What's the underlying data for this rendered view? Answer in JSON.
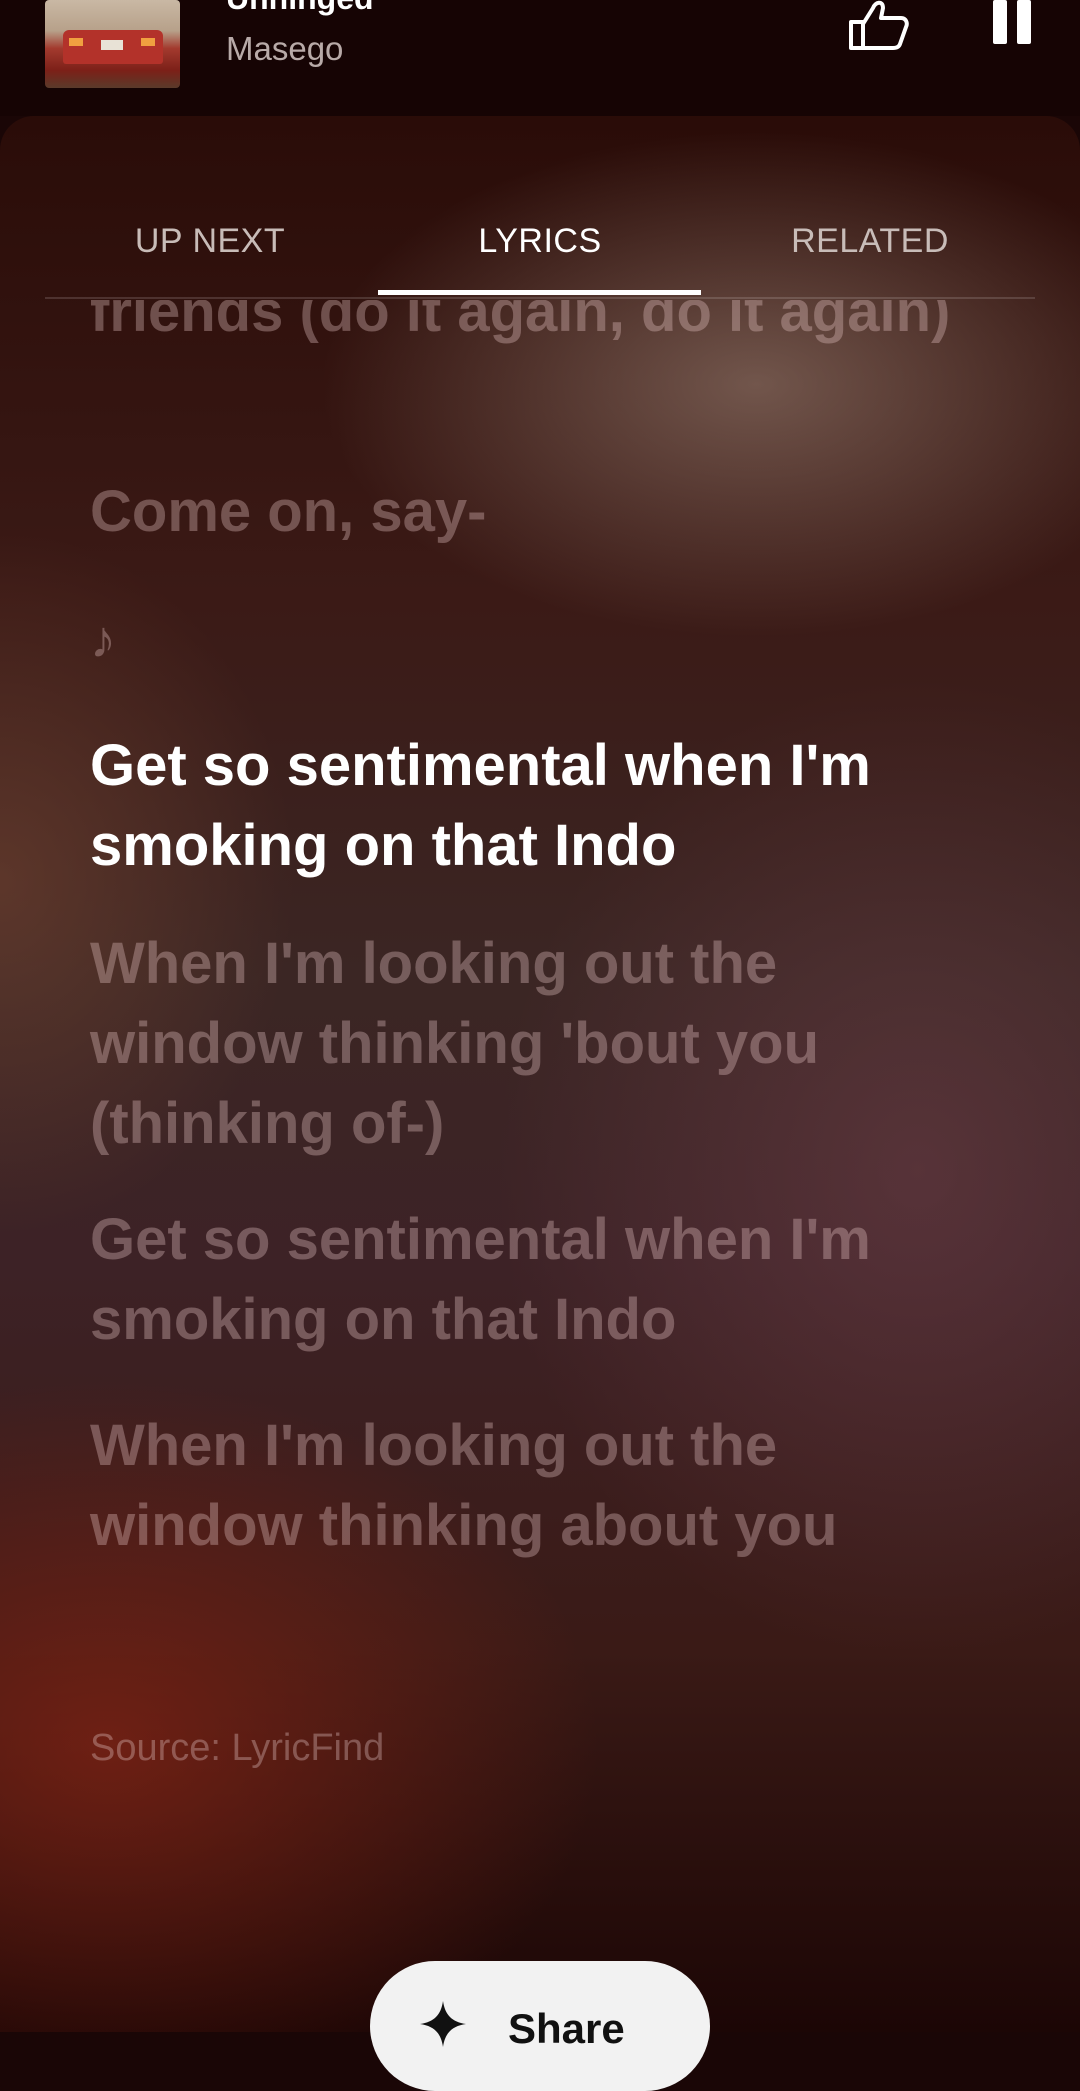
{
  "miniplayer": {
    "title": "Unhinged",
    "artist": "Masego"
  },
  "tabs": [
    {
      "label": "UP NEXT"
    },
    {
      "label": "LYRICS"
    },
    {
      "label": "RELATED"
    }
  ],
  "lyrics": [
    "friends (do it again, do it again)",
    "Come on, say-",
    "♪",
    "Get so sentimental when I'm smoking on that Indo",
    "When I'm looking out the window thinking 'bout you (thinking of-)",
    "Get so sentimental when I'm smoking on that Indo",
    "When I'm looking out the window thinking about you"
  ],
  "source": "Source: LyricFind",
  "share": {
    "label": "Share"
  }
}
